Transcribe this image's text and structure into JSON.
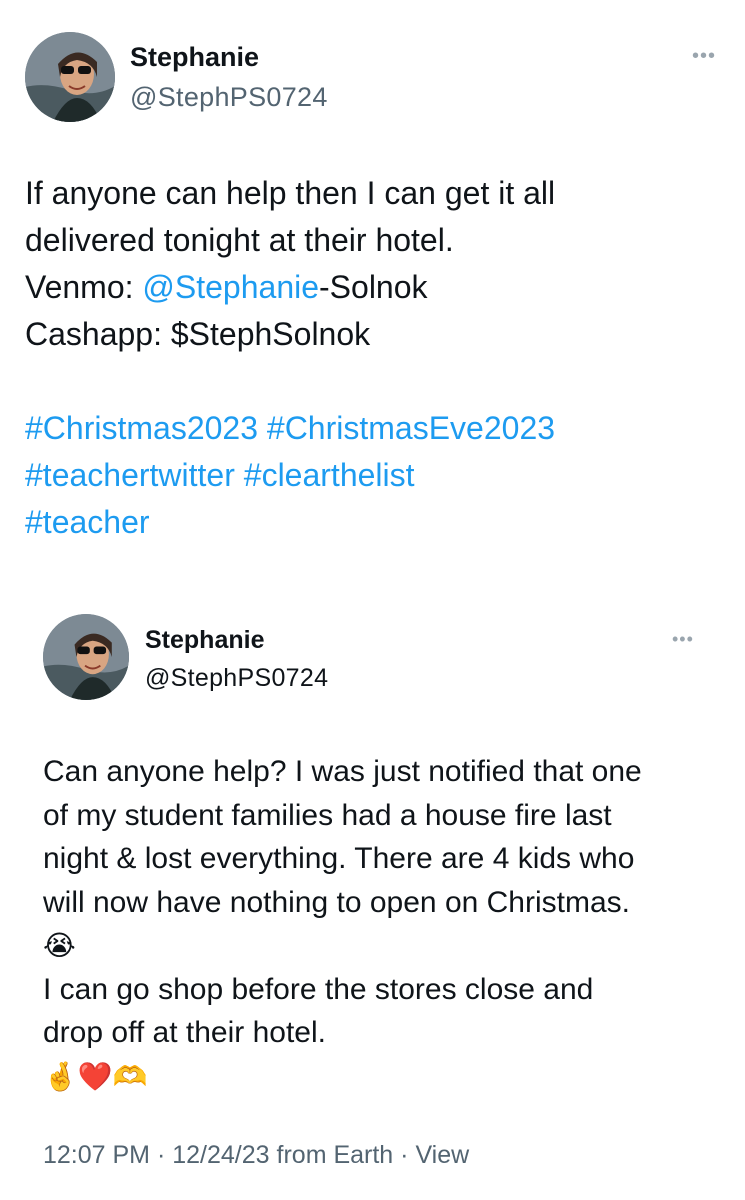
{
  "tweet": {
    "author_name": "Stephanie",
    "handle": "@StephPS0724",
    "more_icon": "more-horizontal-icon",
    "body_line1": "If anyone can help then I can get it all",
    "body_line2": "delivered tonight at their hotel.",
    "venmo_label": "Venmo: ",
    "venmo_mention": "@Stephanie",
    "venmo_suffix": "-Solnok",
    "cashapp": "Cashapp: $StephSolnok",
    "hashtags": [
      "#Christmas2023",
      "#ChristmasEve2023",
      "#teachertwitter",
      "#clearthelist",
      "#teacher"
    ]
  },
  "quoted_tweet": {
    "author_name": "Stephanie",
    "handle": "@StephPS0724",
    "more_icon": "more-horizontal-icon",
    "body_line1": "Can anyone help? I was just notified that one",
    "body_line2": "of my student families had a house fire last",
    "body_line3": "night & lost everything. There are 4 kids who",
    "body_line4": "will now have nothing to open on Christmas.",
    "emoji_crying": "😭",
    "body_line5": "I can go shop before the stores close and",
    "body_line6": "drop off at their hotel.",
    "emoji_fingers": "🤞",
    "emoji_heart": "❤️",
    "emoji_hands": "🫶",
    "time": "12:07 PM",
    "date": "12/24/23",
    "source": "from Earth",
    "separator": " · ",
    "view_label": "View"
  }
}
